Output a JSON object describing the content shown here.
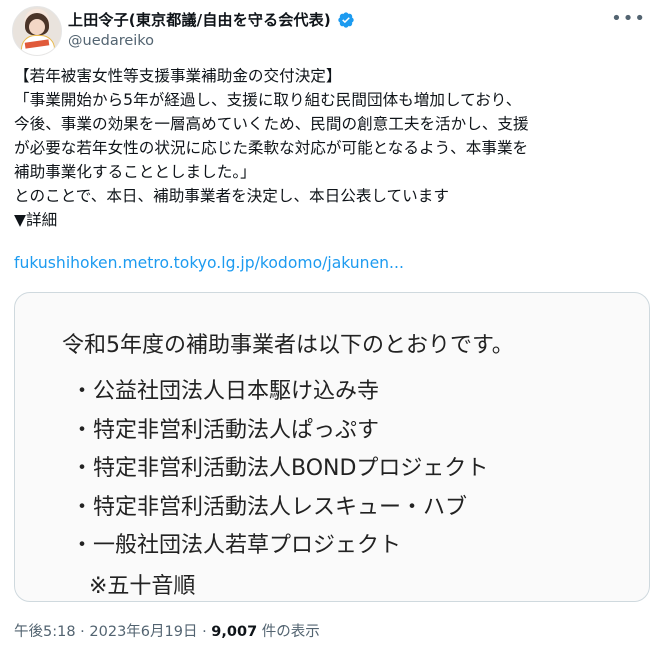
{
  "author": {
    "display_name": "上田令子(東京都議/自由を守る会代表)",
    "handle": "@uedareiko"
  },
  "tweet": {
    "text": "【若年被害女性等支援事業補助金の交付決定】\n「事業開始から5年が経過し、支援に取り組む民間団体も増加しており、\n今後、事業の効果を一層高めていくため、民間の創意工夫を活かし、支援\nが必要な若年女性の状況に応じた柔軟な対応が可能となるよう、本事業を\n補助事業化することとしました。」\nとのことで、本日、補助事業者を決定し、本日公表しています\n▼詳細",
    "link_text": "fukushihoken.metro.tokyo.lg.jp/kodomo/jakunen..."
  },
  "card": {
    "title": "令和5年度の補助事業者は以下のとおりです。",
    "items": [
      "・公益社団法人日本駆け込み寺",
      "・特定非営利活動法人ぱっぷす",
      "・特定非営利活動法人BONDプロジェクト",
      "・特定非営利活動法人レスキュー・ハブ",
      "・一般社団法人若草プロジェクト"
    ],
    "note": "※五十音順"
  },
  "meta": {
    "time": "午後5:18",
    "separator": " · ",
    "date": "2023年6月19日",
    "views_count": "9,007",
    "views_label": " 件の表示"
  },
  "icons": {
    "more": "more-icon",
    "verified": "verified-badge-icon"
  },
  "colors": {
    "accent": "#1d9bf0",
    "muted": "#536471",
    "text": "#0f1419"
  }
}
